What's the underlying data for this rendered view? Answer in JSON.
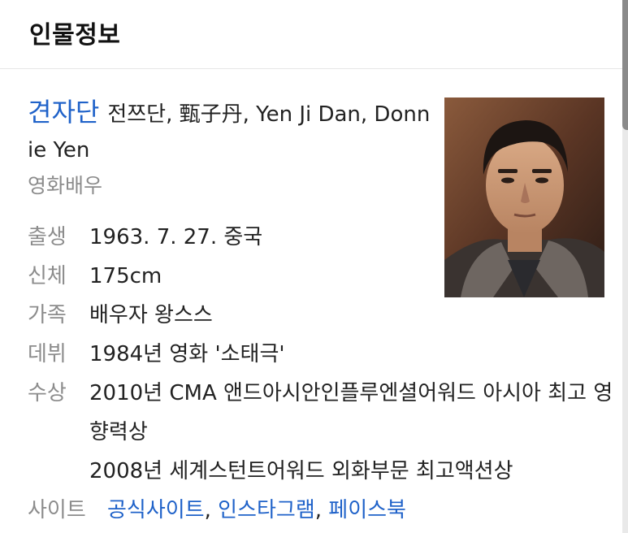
{
  "header": {
    "title": "인물정보"
  },
  "person": {
    "name": "견자단",
    "aliases": "전쯔단, 甄子丹, Yen Ji Dan, Donnie Yen",
    "occupation": "영화배우"
  },
  "info": [
    {
      "label": "출생",
      "value": "1963. 7. 27. 중국"
    },
    {
      "label": "신체",
      "value": "175cm"
    },
    {
      "label": "가족",
      "value": "배우자 왕스스"
    },
    {
      "label": "데뷔",
      "value": "1984년 영화 '소태극'"
    }
  ],
  "awards": {
    "label": "수상",
    "items": [
      "2010년 CMA 앤드아시안인플루엔셜어워드 아시아 최고 영향력상",
      "2008년 세계스턴트어워드 외화부문 최고액션상"
    ]
  },
  "sites": {
    "label": "사이트",
    "links": [
      "공식사이트",
      "인스타그램",
      "페이스북"
    ],
    "separator": ","
  },
  "colors": {
    "accent": "#1f62c9",
    "label": "#8c8c8c"
  }
}
